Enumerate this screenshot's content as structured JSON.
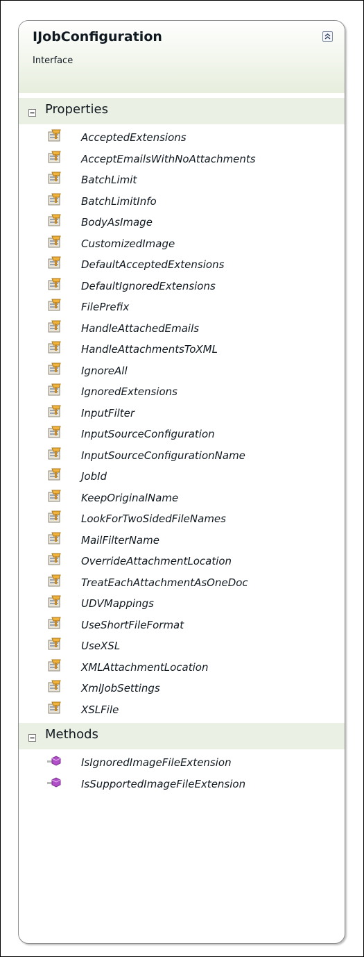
{
  "interface": {
    "name": "IJobConfiguration",
    "kind": "Interface"
  },
  "sections": [
    {
      "title": "Properties",
      "member_icon": "property-icon",
      "items": [
        "AcceptedExtensions",
        "AcceptEmailsWithNoAttachments",
        "BatchLimit",
        "BatchLimitInfo",
        "BodyAsImage",
        "CustomizedImage",
        "DefaultAcceptedExtensions",
        "DefaultIgnoredExtensions",
        "FilePrefix",
        "HandleAttachedEmails",
        "HandleAttachmentsToXML",
        "IgnoreAll",
        "IgnoredExtensions",
        "InputFilter",
        "InputSourceConfiguration",
        "InputSourceConfigurationName",
        "JobId",
        "KeepOriginalName",
        "LookForTwoSidedFileNames",
        "MailFilterName",
        "OverrideAttachmentLocation",
        "TreatEachAttachmentAsOneDoc",
        "UDVMappings",
        "UseShortFileFormat",
        "UseXSL",
        "XMLAttachmentLocation",
        "XmlJobSettings",
        "XSLFile"
      ]
    },
    {
      "title": "Methods",
      "member_icon": "method-icon",
      "items": [
        "IsIgnoredImageFileExtension",
        "IsSupportedImageFileExtension"
      ]
    }
  ],
  "colors": {
    "header_gradient_end": "#e7eedd",
    "section_band": "#eaf0e3",
    "border": "#8e8e8e",
    "method_icon": "#b04fc8"
  }
}
